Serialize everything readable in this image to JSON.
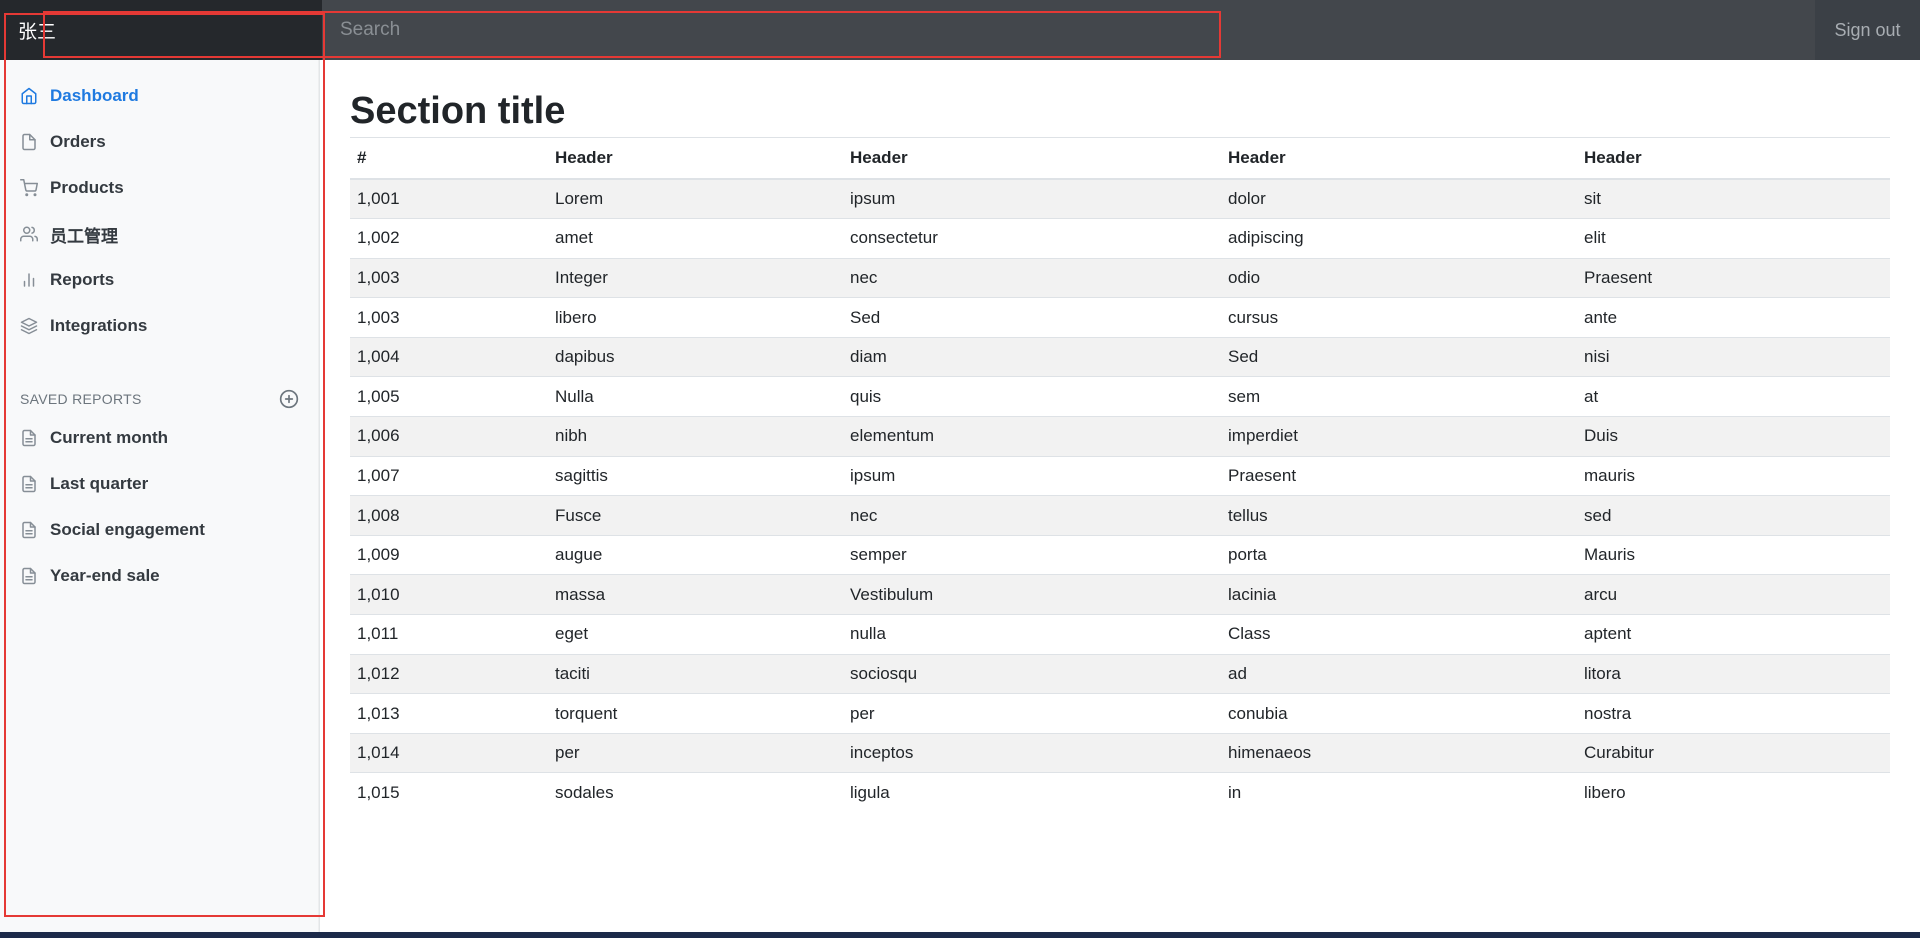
{
  "header": {
    "brand": "张三",
    "search_placeholder": "Search",
    "signout_label": "Sign out"
  },
  "sidebar": {
    "items": [
      {
        "label": "Dashboard",
        "icon": "home-icon",
        "active": true
      },
      {
        "label": "Orders",
        "icon": "file-icon",
        "active": false
      },
      {
        "label": "Products",
        "icon": "shopping-cart-icon",
        "active": false
      },
      {
        "label": "员工管理",
        "icon": "users-icon",
        "active": false
      },
      {
        "label": "Reports",
        "icon": "bar-chart-icon",
        "active": false
      },
      {
        "label": "Integrations",
        "icon": "layers-icon",
        "active": false
      }
    ],
    "saved_heading": "SAVED REPORTS",
    "saved_items": [
      {
        "label": "Current month",
        "icon": "file-text-icon"
      },
      {
        "label": "Last quarter",
        "icon": "file-text-icon"
      },
      {
        "label": "Social engagement",
        "icon": "file-text-icon"
      },
      {
        "label": "Year-end sale",
        "icon": "file-text-icon"
      }
    ]
  },
  "main": {
    "title": "Section title",
    "table": {
      "headers": [
        "#",
        "Header",
        "Header",
        "Header",
        "Header"
      ],
      "rows": [
        [
          "1,001",
          "Lorem",
          "ipsum",
          "dolor",
          "sit"
        ],
        [
          "1,002",
          "amet",
          "consectetur",
          "adipiscing",
          "elit"
        ],
        [
          "1,003",
          "Integer",
          "nec",
          "odio",
          "Praesent"
        ],
        [
          "1,003",
          "libero",
          "Sed",
          "cursus",
          "ante"
        ],
        [
          "1,004",
          "dapibus",
          "diam",
          "Sed",
          "nisi"
        ],
        [
          "1,005",
          "Nulla",
          "quis",
          "sem",
          "at"
        ],
        [
          "1,006",
          "nibh",
          "elementum",
          "imperdiet",
          "Duis"
        ],
        [
          "1,007",
          "sagittis",
          "ipsum",
          "Praesent",
          "mauris"
        ],
        [
          "1,008",
          "Fusce",
          "nec",
          "tellus",
          "sed"
        ],
        [
          "1,009",
          "augue",
          "semper",
          "porta",
          "Mauris"
        ],
        [
          "1,010",
          "massa",
          "Vestibulum",
          "lacinia",
          "arcu"
        ],
        [
          "1,011",
          "eget",
          "nulla",
          "Class",
          "aptent"
        ],
        [
          "1,012",
          "taciti",
          "sociosqu",
          "ad",
          "litora"
        ],
        [
          "1,013",
          "torquent",
          "per",
          "conubia",
          "nostra"
        ],
        [
          "1,014",
          "per",
          "inceptos",
          "himenaeos",
          "Curabitur"
        ],
        [
          "1,015",
          "sodales",
          "ligula",
          "in",
          "libero"
        ]
      ]
    }
  },
  "colors": {
    "navbar": "#343a40",
    "brand_bg": "#25282c",
    "active_link": "#1f7ae0",
    "highlight_frame": "#e53935"
  }
}
